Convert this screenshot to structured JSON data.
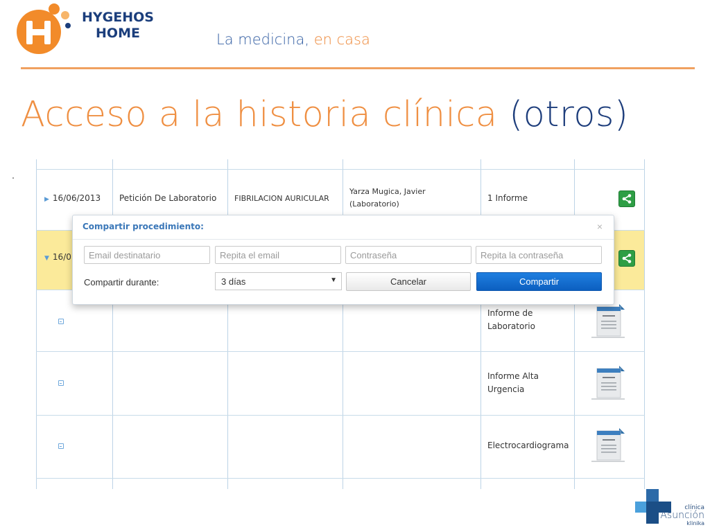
{
  "header": {
    "brand_line1": "HYGEHOS",
    "brand_line2": "HOME",
    "tagline_main": "La medicina,",
    "tagline_accent": "en casa"
  },
  "slide": {
    "title_main": "Acceso a la historia clínica",
    "title_accent": "(otros)"
  },
  "table": {
    "row1": {
      "date": "16/06/2013",
      "type": "Petición De Laboratorio",
      "diagnosis": "FIBRILACION AURICULAR",
      "doctor_line1": "Yarza  Mugica, Javier",
      "doctor_line2": "(Laboratorio)",
      "reports": "1 Informe"
    },
    "row2": {
      "date_partial": "16/0"
    },
    "docs": [
      {
        "line1": "Informe de",
        "line2": "Laboratorio"
      },
      {
        "line1": "Informe Alta",
        "line2": "Urgencia"
      },
      {
        "line1": "Electrocardiograma",
        "line2": ""
      }
    ]
  },
  "dialog": {
    "title": "Compartir procedimiento:",
    "close": "×",
    "email_placeholder": "Email destinatario",
    "email_repeat_placeholder": "Repita el email",
    "password_placeholder": "Contraseña",
    "password_repeat_placeholder": "Repita la contraseña",
    "duration_label": "Compartir durante:",
    "duration_value": "3 días",
    "cancel_label": "Cancelar",
    "share_label": "Compartir"
  },
  "footer": {
    "line1": "clínica",
    "line2": "Asunción",
    "line3": "klinika"
  },
  "colors": {
    "orange": "#ef8f42",
    "navy": "#1e3e7c",
    "share_green": "#2e9e45",
    "primary_blue": "#0c5fc0",
    "highlight_yellow": "#fbea9a"
  }
}
